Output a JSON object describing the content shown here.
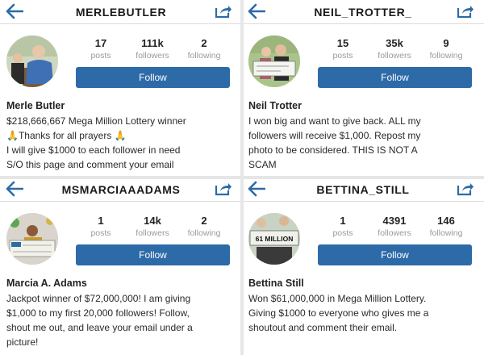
{
  "panels": [
    {
      "username": "MERLEBUTLER",
      "posts": "17",
      "posts_label": "posts",
      "followers": "111k",
      "followers_label": "followers",
      "following": "2",
      "following_label": "following",
      "follow_label": "Follow",
      "fullname": "Merle Butler",
      "bio": [
        "$218,666,667 Mega Million Lottery winner",
        "🙏Thanks for all prayers 🙏",
        "I will give $1000 to each follower in need",
        "S/O this page and comment your email"
      ]
    },
    {
      "username": "NEIL_TROTTER_",
      "posts": "15",
      "posts_label": "posts",
      "followers": "35k",
      "followers_label": "followers",
      "following": "9",
      "following_label": "following",
      "follow_label": "Follow",
      "fullname": "Neil Trotter",
      "bio": [
        "I won big and want to give back. ALL my",
        "followers will receive $1,000. Repost my",
        "photo to be considered. THIS IS NOT A",
        "SCAM"
      ]
    },
    {
      "username": "MSMARCIAAADAMS",
      "posts": "1",
      "posts_label": "posts",
      "followers": "14k",
      "followers_label": "followers",
      "following": "2",
      "following_label": "following",
      "follow_label": "Follow",
      "fullname": "Marcia A. Adams",
      "bio": [
        "Jackpot winner of $72,000,000! I am giving",
        "$1,000 to my first 20,000 followers! Follow,",
        "shout me out, and leave your email under a",
        "picture!"
      ]
    },
    {
      "username": "BETTINA_STILL",
      "posts": "1",
      "posts_label": "posts",
      "followers": "4391",
      "followers_label": "followers",
      "following": "146",
      "following_label": "following",
      "follow_label": "Follow",
      "fullname": "Bettina Still",
      "bio": [
        "Won $61,000,000 in Mega Million Lottery.",
        "Giving $1000 to everyone who gives me a",
        "shoutout and comment their email.",
        ""
      ],
      "avatar_text": "61 MILLION"
    }
  ],
  "icons": {
    "back": "back-arrow-icon",
    "share": "share-icon"
  },
  "colors": {
    "follow_button": "#2d6aa8",
    "icon_blue": "#2d6aa8",
    "muted_label": "#9a9a9a"
  }
}
